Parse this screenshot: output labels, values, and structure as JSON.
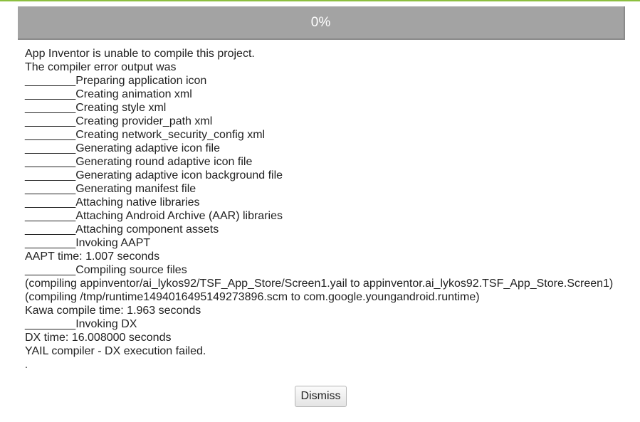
{
  "progress": {
    "label": "0%",
    "value": 0
  },
  "log_lines": [
    "App Inventor is unable to compile this project.",
    "The compiler error output was",
    "________Preparing application icon",
    "________Creating animation xml",
    "________Creating style xml",
    "________Creating provider_path xml",
    "________Creating network_security_config xml",
    "________Generating adaptive icon file",
    "________Generating round adaptive icon file",
    "________Generating adaptive icon background file",
    "________Generating manifest file",
    "________Attaching native libraries",
    "________Attaching Android Archive (AAR) libraries",
    "________Attaching component assets",
    "________Invoking AAPT",
    "AAPT time: 1.007 seconds",
    "________Compiling source files",
    "(compiling appinventor/ai_lykos92/TSF_App_Store/Screen1.yail to appinventor.ai_lykos92.TSF_App_Store.Screen1)",
    "(compiling /tmp/runtime1494016495149273896.scm to com.google.youngandroid.runtime)",
    "Kawa compile time: 1.963 seconds",
    "________Invoking DX",
    "DX time: 16.008000 seconds",
    "YAIL compiler - DX execution failed."
  ],
  "trailing_mark": ".",
  "dismiss_button": {
    "label": "Dismiss"
  },
  "colors": {
    "accent": "#8cbf3f",
    "progress_bg": "#a3a3a3"
  }
}
